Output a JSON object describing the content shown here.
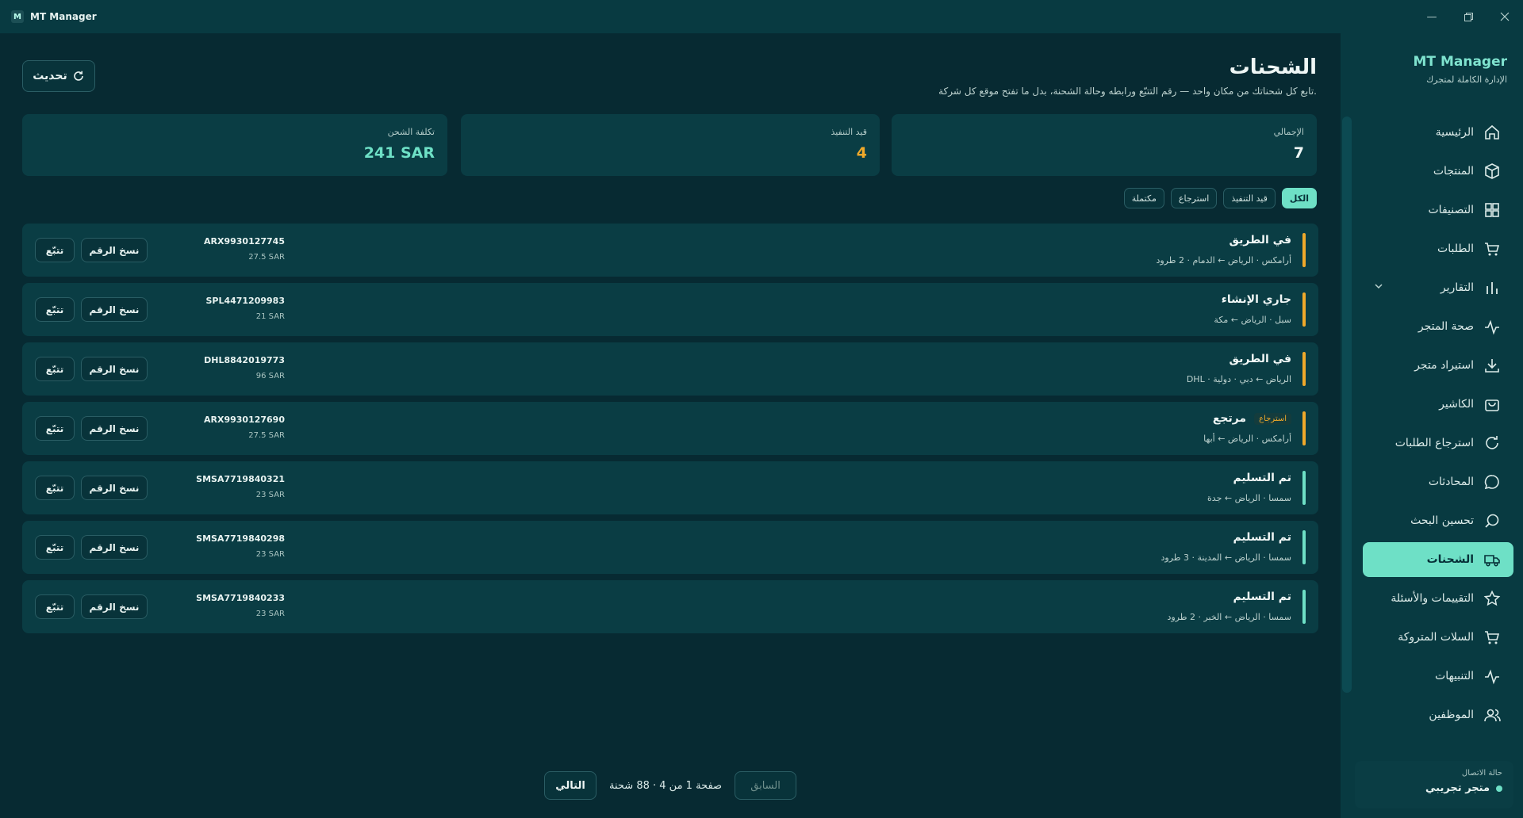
{
  "window": {
    "title": "MT Manager",
    "logo_letter": "M"
  },
  "sidebar": {
    "brand_title": "MT Manager",
    "brand_subtitle": "الإدارة الكاملة لمتجرك",
    "items": [
      {
        "label": "الرئيسية",
        "icon": "home-icon"
      },
      {
        "label": "المنتجات",
        "icon": "box-icon"
      },
      {
        "label": "التصنيفات",
        "icon": "grid-icon"
      },
      {
        "label": "الطلبات",
        "icon": "cart-icon"
      },
      {
        "label": "التقارير",
        "icon": "chart-icon"
      },
      {
        "label": "صحة المتجر",
        "icon": "pulse-icon"
      },
      {
        "label": "استيراد متجر",
        "icon": "download-icon"
      },
      {
        "label": "الكاشير",
        "icon": "bag-icon"
      },
      {
        "label": "استرجاع الطلبات",
        "icon": "refresh-icon"
      },
      {
        "label": "المحادثات",
        "icon": "chat-icon"
      },
      {
        "label": "تحسين البحث",
        "icon": "search-icon"
      },
      {
        "label": "الشحنات",
        "icon": "truck-icon"
      },
      {
        "label": "التقييمات والأسئلة",
        "icon": "star-icon"
      },
      {
        "label": "السلات المتروكة",
        "icon": "cart-icon"
      },
      {
        "label": "التنبيهات",
        "icon": "pulse-icon"
      },
      {
        "label": "الموظفين",
        "icon": "users-icon"
      }
    ],
    "active_item": "الشحنات",
    "connection_label": "حالة الاتصال",
    "connection_value": "متجر تجريبي"
  },
  "header": {
    "title": "الشحنات",
    "subtitle": "تابع كل شحناتك من مكان واحد — رقم التتبّع ورابطه وحالة الشحنة، بدل ما تفتح موقع كل شركة.",
    "refresh_label": "تحديث"
  },
  "stats": [
    {
      "label": "الإجمالي",
      "value": "7",
      "color": "#eef6f5"
    },
    {
      "label": "قيد التنفيذ",
      "value": "4",
      "color": "#f0a92a"
    },
    {
      "label": "تكلفة الشحن",
      "value": "241 SAR",
      "color": "#6ee0c6"
    }
  ],
  "filters": [
    "الكل",
    "قيد التنفيذ",
    "استرجاع",
    "مكتملة"
  ],
  "active_filter": "الكل",
  "shipments": [
    {
      "status": "في الطريق",
      "badge": "",
      "route": "أرامكس · الرياض ← الدمام · 2 طرود",
      "tracking": "ARX9930127745",
      "cost": "27.5 SAR",
      "bar_color": "#f0a92a"
    },
    {
      "status": "جاري الإنشاء",
      "badge": "",
      "route": "سبل · الرياض ← مكة",
      "tracking": "SPL4471209983",
      "cost": "21 SAR",
      "bar_color": "#f0a92a"
    },
    {
      "status": "في الطريق",
      "badge": "",
      "route": "DHL · الرياض ← دبي · دولية",
      "tracking": "DHL8842019773",
      "cost": "96 SAR",
      "bar_color": "#f0a92a"
    },
    {
      "status": "مرتجع",
      "badge": "استرجاع",
      "route": "أرامكس · الرياض ← أبها",
      "tracking": "ARX9930127690",
      "cost": "27.5 SAR",
      "bar_color": "#f0a92a"
    },
    {
      "status": "تم التسليم",
      "badge": "",
      "route": "سمسا · الرياض ← جدة",
      "tracking": "SMSA7719840321",
      "cost": "23 SAR",
      "bar_color": "#6ee0c6"
    },
    {
      "status": "تم التسليم",
      "badge": "",
      "route": "سمسا · الرياض ← المدينة · 3 طرود",
      "tracking": "SMSA7719840298",
      "cost": "23 SAR",
      "bar_color": "#6ee0c6"
    },
    {
      "status": "تم التسليم",
      "badge": "",
      "route": "سمسا · الرياض ← الخبر · 2 طرود",
      "tracking": "SMSA7719840233",
      "cost": "23 SAR",
      "bar_color": "#6ee0c6"
    }
  ],
  "row_actions": {
    "copy_label": "نسخ الرقم",
    "track_label": "تتبّع"
  },
  "pagination": {
    "next_label": "التالي",
    "prev_label": "السابق",
    "info": "صفحة 1 من 4 · 88 شحنة"
  }
}
